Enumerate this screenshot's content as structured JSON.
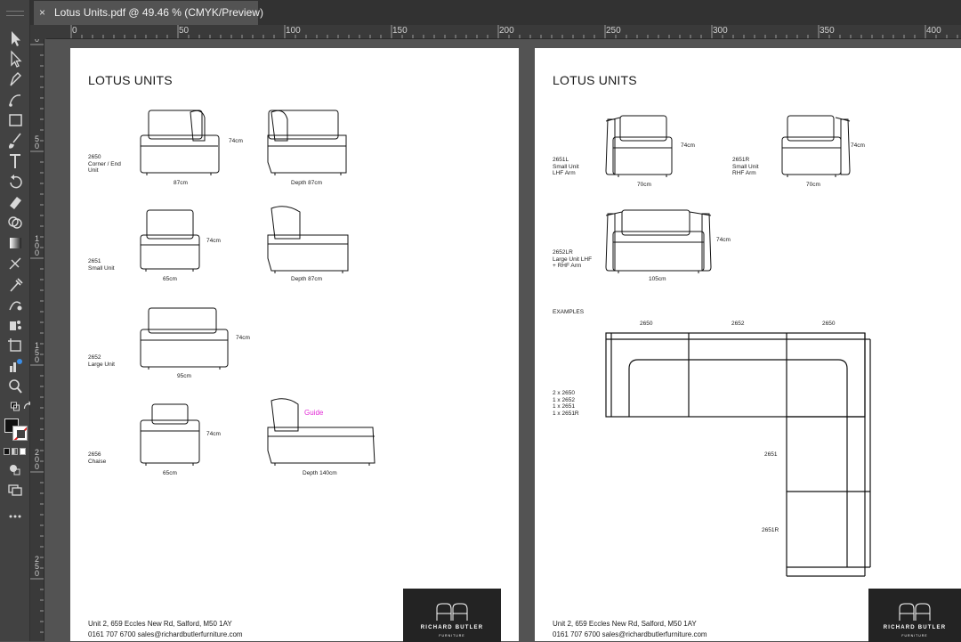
{
  "document_tab": {
    "close_glyph": "×",
    "title": "Lotus Units.pdf  @ 49.46 % (CMYK/Preview)"
  },
  "tools": [
    "selection-tool-icon",
    "direct-selection-tool-icon",
    "pen-tool-icon",
    "curvature-tool-icon",
    "rectangle-tool-icon",
    "paintbrush-tool-icon",
    "type-tool-icon",
    "rotate-tool-icon",
    "eraser-tool-icon",
    "shape-builder-tool-icon",
    "gradient-tool-icon",
    "mesh-tool-icon",
    "eyedropper-tool-icon",
    "blend-tool-icon",
    "symbol-sprayer-tool-icon",
    "artboard-tool-icon",
    "chart-tool-icon",
    "zoom-tool-icon",
    "more-tools-icon"
  ],
  "rulers": {
    "horizontal": [
      "0",
      "50",
      "100",
      "150",
      "200",
      "250",
      "300",
      "350",
      "400"
    ],
    "vertical": [
      "0",
      "50",
      "100",
      "150",
      "200",
      "250"
    ]
  },
  "page_left": {
    "heading": "LOTUS UNITS",
    "labels": {
      "u2650": "2650\nCorner / End\nUnit",
      "u2651": "2651\nSmall Unit",
      "u2652": "2652\nLarge Unit",
      "u2656": "2656\nChaise"
    },
    "dims": {
      "h2650": "74cm",
      "w2650": "87cm",
      "d2650": "Depth 87cm",
      "h2651": "74cm",
      "w2651": "65cm",
      "d2651": "Depth 87cm",
      "h2652": "74cm",
      "w2652": "95cm",
      "h2656": "74cm",
      "w2656": "65cm",
      "d2656": "Depth 140cm"
    },
    "guide_label": "Guide",
    "footer_address": "Unit 2, 659 Eccles New Rd, Salford, M50 1AY",
    "footer_contact": "0161 707 6700    sales@richardbutlerfurniture.com"
  },
  "page_right": {
    "heading": "LOTUS UNITS",
    "labels": {
      "u2651L": "2651L\nSmall Unit\nLHF Arm",
      "u2651R": "2651R\nSmall Unit\nRHF Arm",
      "u2652LR": "2652LR\nLarge Unit LHF\n+ RHF Arm"
    },
    "dims": {
      "h2651L": "74cm",
      "w2651L": "70cm",
      "h2651R": "74cm",
      "w2651R": "70cm",
      "h2652LR": "74cm",
      "w2652LR": "105cm"
    },
    "examples": {
      "title": "EXAMPLES",
      "top_labels": [
        "2650",
        "2652",
        "2650"
      ],
      "counts": "2 x 2650\n1 x 2652\n1 x 2651\n1 x 2651R",
      "side_2651": "2651",
      "side_2651R": "2651R"
    },
    "footer_address": "Unit 2, 659 Eccles New Rd, Salford, M50 1AY",
    "footer_contact": "0161 707 6700    sales@richardbutlerfurniture.com"
  },
  "brand": {
    "name": "RICHARD BUTLER",
    "sub": "FURNITURE"
  },
  "colors": {
    "app_bg": "#535353",
    "toolbar": "#424242",
    "guide": "#e22bd6",
    "logo_bg": "#232323"
  }
}
